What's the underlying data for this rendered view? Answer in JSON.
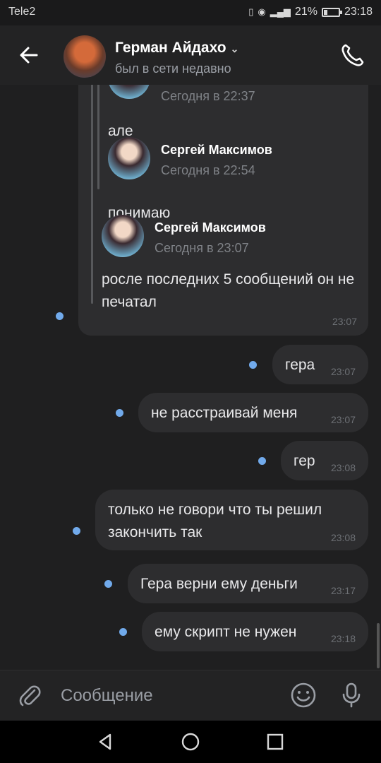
{
  "status_bar": {
    "carrier": "Tele2",
    "battery": "21%",
    "battery_level": 0.21,
    "time": "23:18"
  },
  "header": {
    "name": "Герман Айдахо",
    "status": "был в сети недавно"
  },
  "forwarded": [
    {
      "author": "",
      "date": "Сегодня в 22:37",
      "text": "але"
    },
    {
      "author": "Сергей Максимов",
      "date": "Сегодня в 22:54",
      "text": "понимаю"
    },
    {
      "author": "Сергей Максимов",
      "date": "Сегодня в 23:07",
      "text": "росле последних 5 сообщений он не печатал"
    }
  ],
  "forwarded_time": "23:07",
  "messages": [
    {
      "text": "гера",
      "time": "23:07"
    },
    {
      "text": "не расстраивай меня",
      "time": "23:07"
    },
    {
      "text": "гер",
      "time": "23:08"
    },
    {
      "text": "только не говори что ты решил закончить так",
      "time": "23:08"
    },
    {
      "text": "Гера верни ему деньги",
      "time": "23:17"
    },
    {
      "text": "ему скрипт не нужен",
      "time": "23:18"
    }
  ],
  "composer": {
    "placeholder": "Сообщение"
  },
  "icons": {
    "back": "arrow-left-icon",
    "call": "phone-icon",
    "attach": "paperclip-icon",
    "emoji": "smiley-icon",
    "mic": "microphone-icon",
    "nav_back": "triangle-back-icon",
    "nav_home": "circle-home-icon",
    "nav_recent": "square-recent-icon"
  },
  "colors": {
    "accent": "#71aaeb",
    "bubble": "#2d2d2f",
    "background": "#1f1f20"
  }
}
